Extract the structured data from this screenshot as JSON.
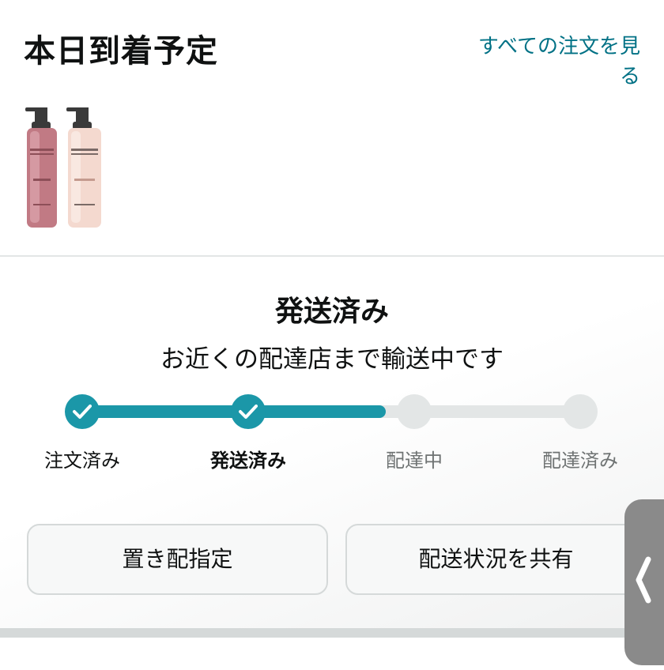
{
  "header": {
    "title": "本日到着予定",
    "view_all_link": "すべての注文を見る"
  },
  "product": {
    "image": "product-bottles-thumbnail"
  },
  "shipment": {
    "status_title": "発送済み",
    "status_message": "お近くの配達店まで輸送中です",
    "progress": 0.61,
    "steps": [
      {
        "label": "注文済み",
        "state": "done"
      },
      {
        "label": "発送済み",
        "state": "current"
      },
      {
        "label": "配達中",
        "state": "pending"
      },
      {
        "label": "配達済み",
        "state": "pending"
      }
    ]
  },
  "actions": {
    "left_button": "置き配指定",
    "right_button": "配送状況を共有"
  },
  "side_handle": {
    "icon": "chevron-left-icon"
  },
  "colors": {
    "accent": "#1b97a8",
    "link": "#007185",
    "track": "#e3e6e6"
  }
}
